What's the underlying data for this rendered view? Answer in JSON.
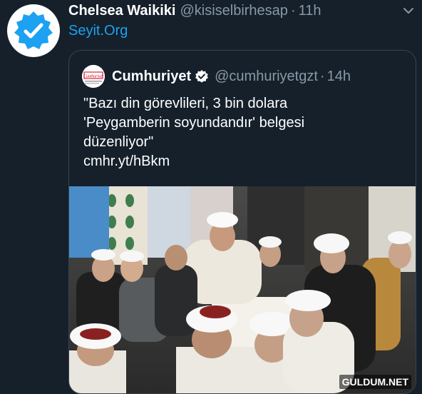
{
  "tweet": {
    "author_name": "Chelsea Waikiki",
    "author_handle": "@kisiselbirhesap",
    "separator": "·",
    "time": "11h",
    "link_text": "Seyit.Org"
  },
  "quoted_tweet": {
    "account_name": "Cumhuriyet",
    "account_handle": "@cumhuriyetgzt",
    "separator": "·",
    "time": "14h",
    "logo_text": "Cumhuriyet",
    "text_lines": [
      "\"Bazı din görevlileri, 3 bin dolara",
      "'Peygamberin soyundandır' belgesi",
      "düzenliyor\"",
      "cmhr.yt/hBkm"
    ]
  },
  "watermark": "GULDUM.NET",
  "colors": {
    "background": "#15202b",
    "link": "#1da1f2",
    "secondary_text": "#8899a6",
    "border": "#38444d"
  },
  "icons": [
    "verified-badge-icon",
    "chevron-down-icon"
  ]
}
